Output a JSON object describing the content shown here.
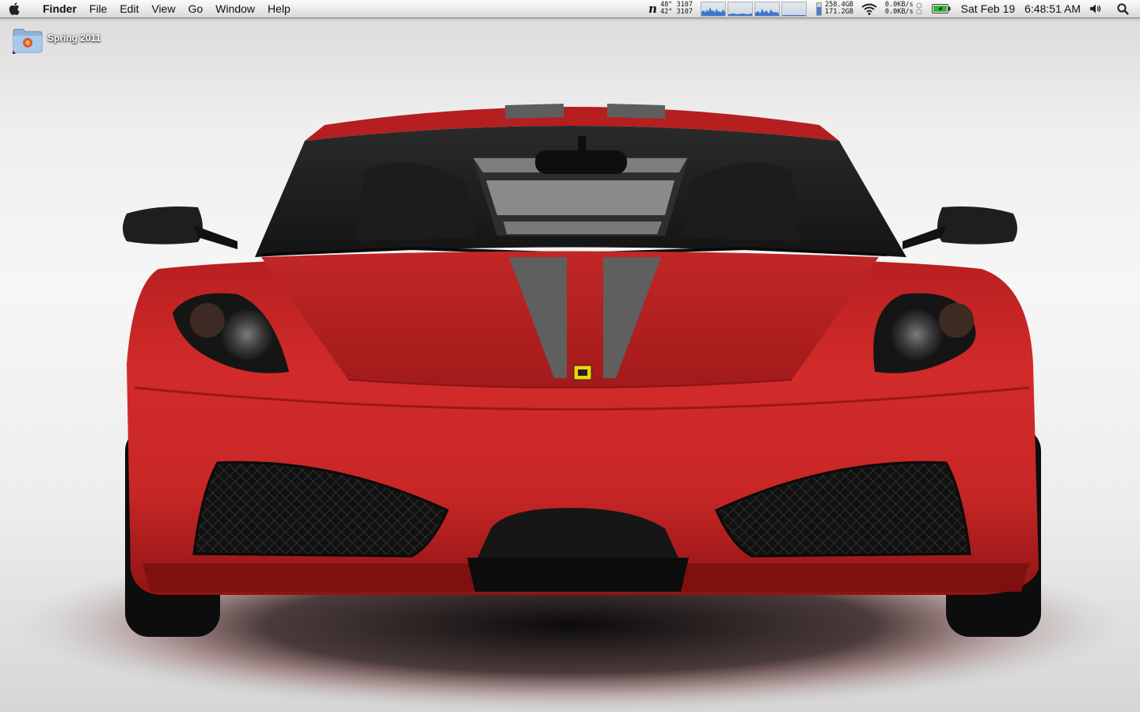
{
  "menubar": {
    "apple_icon": "apple-logo-icon",
    "app_name": "Finder",
    "menus": [
      "File",
      "Edit",
      "View",
      "Go",
      "Window",
      "Help"
    ],
    "extras": {
      "weather_icon": "n-app-icon",
      "temp_line_1": "48° 3107",
      "temp_line_2": "42° 3107",
      "disk_line_1": "258.4GB",
      "disk_line_2": "171.2GB",
      "disk_fill": 0.66,
      "net_line_1": "0.0KB/s",
      "net_line_2": "0.0KB/s",
      "battery_fill": 1.0
    },
    "date": "Sat Feb 19",
    "time": "6:48:51 AM"
  },
  "desktop": {
    "items": [
      {
        "label": "Spring 2011",
        "icon": "folder-icon"
      }
    ]
  },
  "colors": {
    "car_red": "#c92323",
    "stripe_gray": "#5e5e5e",
    "background": "#f2f2f2"
  }
}
